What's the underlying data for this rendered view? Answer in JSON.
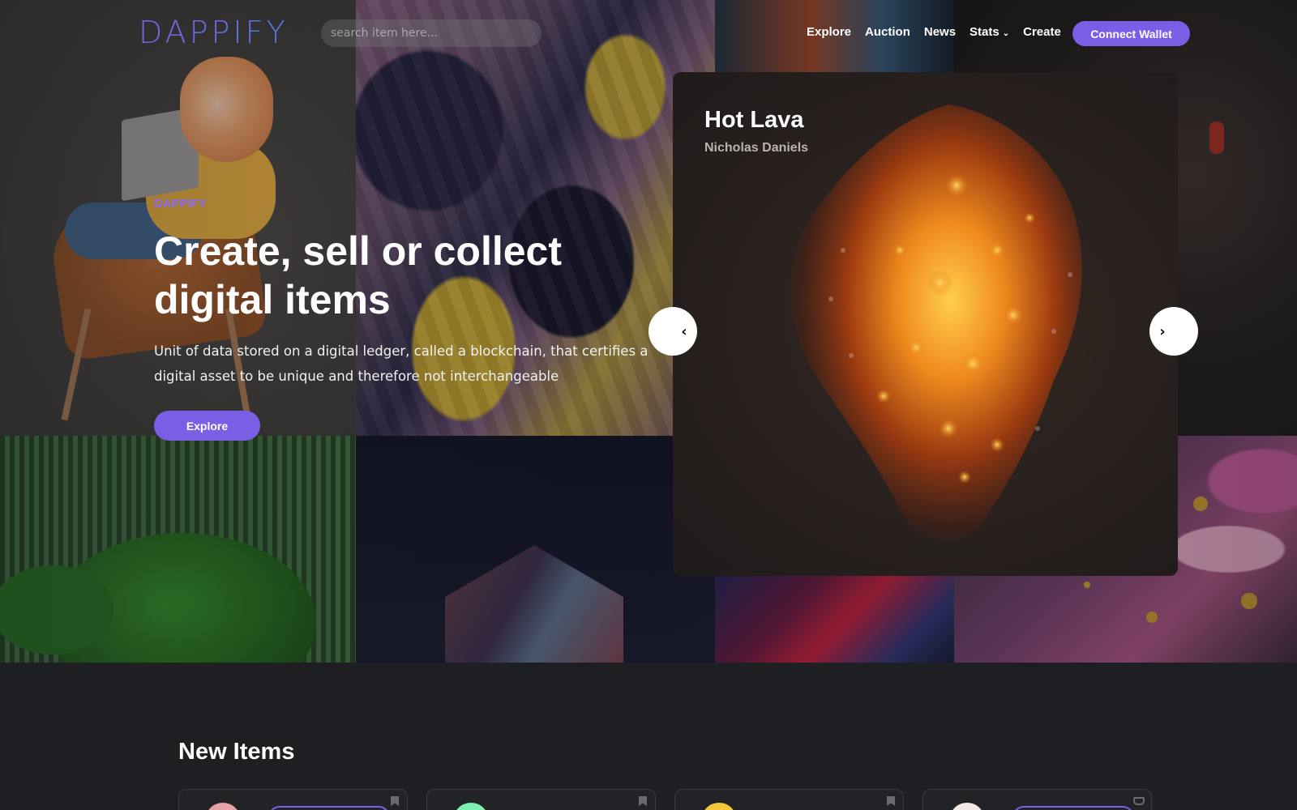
{
  "brand": {
    "logo_text": "DAPPIFY",
    "accent": "#7b5ee6"
  },
  "search": {
    "placeholder": "search item here..."
  },
  "nav": {
    "links": [
      "Explore",
      "Auction",
      "News",
      "Stats",
      "Create"
    ],
    "connect_label": "Connect Wallet"
  },
  "hero": {
    "tag": "DAPPIFY",
    "title": "Create, sell or collect digital items",
    "description": "Unit of data stored on a digital ledger, called a blockchain, that certifies a digital asset to be unique and therefore not interchangeable",
    "cta_label": "Explore"
  },
  "featured": {
    "title": "Hot Lava",
    "artist": "Nicholas Daniels",
    "prev_icon": "chevron-left-icon",
    "next_icon": "chevron-right-icon"
  },
  "new_items": {
    "title": "New Items",
    "cards": [
      {
        "avatar_color": "#e7a2a8",
        "icon": "bookmark-icon",
        "has_pill": true
      },
      {
        "avatar_color": "#7df0b0",
        "icon": "bookmark-icon",
        "has_pill": false
      },
      {
        "avatar_color": "#f5c637",
        "icon": "bookmark-icon",
        "has_pill": false
      },
      {
        "avatar_color": "#f2e8e4",
        "icon": "basket-icon",
        "has_pill": true
      }
    ]
  }
}
